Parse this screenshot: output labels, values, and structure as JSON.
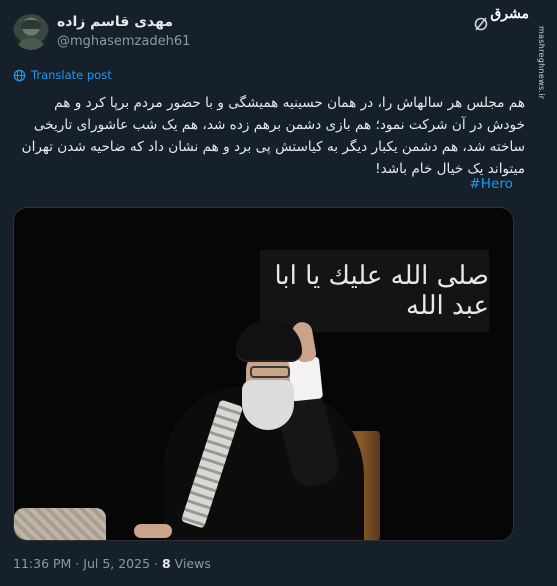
{
  "header": {
    "display_name": "مهدی قاسم زاده",
    "handle": "@mghasemzadeh61",
    "brand_logo": "مشرق",
    "brand_site": "mashreghnews.ir"
  },
  "translate_label": "Translate post",
  "post": {
    "text": "هم مجلس هر سالهاش را، در همان حسینیه همیشگی و با حضور مردم برپا کرد و هم خودش در آن شرکت نمود؛ هم بازی دشمن برهم زده شد، هم یک شب عاشورای تاریخی ساخته شد، هم دشمن یکبار دیگر به کیاستش پی برد و هم نشان داد که ضاحیه شدن تهران میتواند یک خیال خام باشد!",
    "hashtag": "#Hero"
  },
  "media": {
    "banner_text": "صلى الله عليك يا ابا عبد الله"
  },
  "footer": {
    "time": "11:36 PM",
    "date": "Jul 5, 2025",
    "views_count": "8",
    "views_label": "Views"
  },
  "icons": {
    "grok": "grok-icon",
    "globe": "globe-icon"
  },
  "colors": {
    "background": "#15202b",
    "text": "#e7e9ea",
    "secondary": "#8b98a5",
    "link": "#1d9bf0"
  }
}
